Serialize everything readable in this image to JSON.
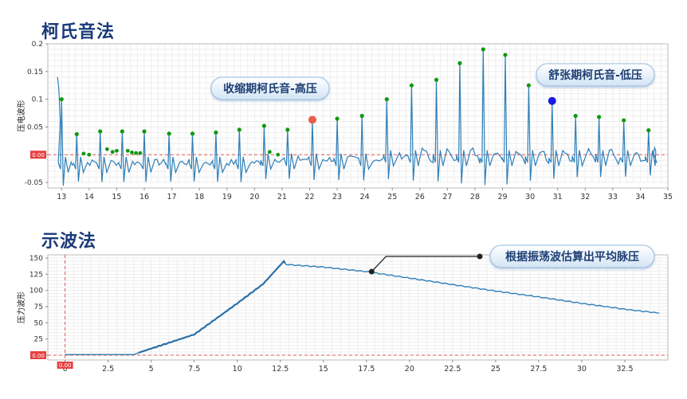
{
  "titles": {
    "top": "柯氏音法",
    "bottom": "示波法"
  },
  "chart_data": [
    {
      "type": "line",
      "ylabel": "压电波形",
      "xlim": [
        12.5,
        35
      ],
      "ylim": [
        -0.06,
        0.2
      ],
      "x_ticks": [
        "13",
        "14",
        "15",
        "16",
        "17",
        "18",
        "19",
        "20",
        "21",
        "22",
        "23",
        "24",
        "25",
        "26",
        "27",
        "28",
        "29",
        "30",
        "31",
        "32",
        "33",
        "34",
        "35"
      ],
      "y_ticks": [
        "0.2",
        "0.15",
        "0.1",
        "0.05",
        "0",
        "-0.05"
      ],
      "reference_line": {
        "value": 0,
        "label": "0.00",
        "color": "#e05a5a"
      },
      "series": [
        {
          "color": "#2e7fb8"
        }
      ],
      "beats": [
        {
          "x": 13.0,
          "peak": 0.1
        },
        {
          "x": 13.55,
          "peak": 0.037
        },
        {
          "x": 14.4,
          "peak": 0.042
        },
        {
          "x": 15.2,
          "peak": 0.042
        },
        {
          "x": 16.0,
          "peak": 0.042
        },
        {
          "x": 16.9,
          "peak": 0.038
        },
        {
          "x": 17.75,
          "peak": 0.038
        },
        {
          "x": 18.6,
          "peak": 0.04
        },
        {
          "x": 19.45,
          "peak": 0.045
        },
        {
          "x": 20.35,
          "peak": 0.052
        },
        {
          "x": 21.2,
          "peak": 0.045
        },
        {
          "x": 22.1,
          "peak": 0.062
        },
        {
          "x": 23.0,
          "peak": 0.065
        },
        {
          "x": 23.9,
          "peak": 0.07
        },
        {
          "x": 24.8,
          "peak": 0.1
        },
        {
          "x": 25.7,
          "peak": 0.125
        },
        {
          "x": 26.6,
          "peak": 0.135
        },
        {
          "x": 27.45,
          "peak": 0.165
        },
        {
          "x": 28.3,
          "peak": 0.19
        },
        {
          "x": 29.1,
          "peak": 0.18
        },
        {
          "x": 29.95,
          "peak": 0.125
        },
        {
          "x": 30.8,
          "peak": 0.095
        },
        {
          "x": 31.65,
          "peak": 0.07
        },
        {
          "x": 32.5,
          "peak": 0.068
        },
        {
          "x": 33.4,
          "peak": 0.062
        },
        {
          "x": 34.3,
          "peak": 0.044
        }
      ],
      "minor_markers": [
        {
          "x": 13.8,
          "y": 0.002
        },
        {
          "x": 14.0,
          "y": 0.0
        },
        {
          "x": 14.65,
          "y": 0.01
        },
        {
          "x": 14.85,
          "y": 0.005
        },
        {
          "x": 15.0,
          "y": 0.007
        },
        {
          "x": 15.4,
          "y": 0.007
        },
        {
          "x": 15.55,
          "y": 0.004
        },
        {
          "x": 15.7,
          "y": 0.003
        },
        {
          "x": 15.85,
          "y": 0.003
        },
        {
          "x": 20.55,
          "y": 0.005
        },
        {
          "x": 20.85,
          "y": 0.0
        }
      ],
      "markers_color": "#119911",
      "highlights": [
        {
          "x": 22.1,
          "y": 0.063,
          "color": "#e8604c"
        },
        {
          "x": 30.8,
          "y": 0.097,
          "color": "#1a1ae0"
        }
      ],
      "annotations": [
        {
          "text": "收缩期柯氏音-高压"
        },
        {
          "text": "舒张期柯氏音-低压"
        }
      ]
    },
    {
      "type": "line",
      "ylabel": "压力波形",
      "xlim": [
        -1,
        35
      ],
      "ylim": [
        0,
        150
      ],
      "x_ticks": [
        "0",
        "2.5",
        "5",
        "7.5",
        "10",
        "12.5",
        "15",
        "17.5",
        "20",
        "22.5",
        "25",
        "27.5",
        "30",
        "32.5"
      ],
      "y_ticks": [
        "150",
        "125",
        "100",
        "75",
        "50",
        "25",
        "0"
      ],
      "reference_line": {
        "value": 0,
        "label": "0.00",
        "color": "#e05a5a"
      },
      "vertical_ref": {
        "value": 0,
        "label": "0.00"
      },
      "series": [
        {
          "color": "#2e7fb8",
          "x": [
            0,
            4.0,
            4.4,
            7.5,
            10.0,
            11.5,
            12.7,
            12.85,
            15,
            17.5,
            20,
            22.5,
            25,
            27.5,
            30,
            32.5,
            34.5
          ],
          "y": [
            1,
            1,
            5,
            32,
            80,
            110,
            145,
            140,
            136,
            129,
            119,
            109,
            99,
            90,
            80,
            71,
            65
          ]
        }
      ],
      "marker_point": {
        "x": 17.8,
        "y": 129
      },
      "annotation": {
        "text": "根据振荡波估算出平均脉压"
      }
    }
  ]
}
